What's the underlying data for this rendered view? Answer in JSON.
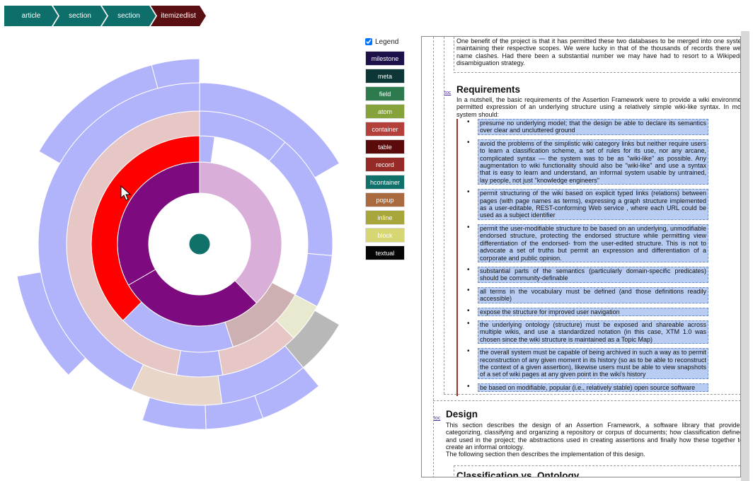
{
  "breadcrumb": [
    {
      "label": "article",
      "color": "#0e6e6a"
    },
    {
      "label": "section",
      "color": "#0e6e6a"
    },
    {
      "label": "section",
      "color": "#0e6e6a"
    },
    {
      "label": "itemizedlist",
      "color": "#5a0f12"
    }
  ],
  "legend": {
    "title": "Legend",
    "checked": true,
    "items": [
      {
        "label": "milestone",
        "color": "#1e1048"
      },
      {
        "label": "meta",
        "color": "#0d3636"
      },
      {
        "label": "field",
        "color": "#2c7a4e"
      },
      {
        "label": "atom",
        "color": "#86a23a"
      },
      {
        "label": "container",
        "color": "#b4403c"
      },
      {
        "label": "table",
        "color": "#5a0a0a"
      },
      {
        "label": "record",
        "color": "#962a26"
      },
      {
        "label": "hcontainer",
        "color": "#10706a"
      },
      {
        "label": "popup",
        "color": "#a86a3e"
      },
      {
        "label": "inline",
        "color": "#a6a63a"
      },
      {
        "label": "block",
        "color": "#d6d672"
      },
      {
        "label": "textual",
        "color": "#050505"
      }
    ]
  },
  "doc": {
    "intro_text": "One benefit of the project is that it has permitted these two databases to be merged into one system maintaining their respective scopes. We were lucky in that of the thousands of records there were name clashes. Had there been a substantial number we may have had to resort to a Wikipedia-disambiguation strategy.",
    "toc_label": "toc",
    "req_heading": "Requirements",
    "req_intro": "In a nutshell, the basic requirements of the Assertion Framework were to provide a wiki environment permitted expression of an underlying structure using a relatively simple wiki-like syntax. In more system should:",
    "req_items": [
      "presume no underlying model; that the design be able to declare its semantics over clear and uncluttered ground",
      "avoid the problems of the simplistic wiki category links but neither require users to learn a classification scheme, a set of rules for its use, nor any arcane, complicated syntax — the system was to be as \"wiki-like\" as possible. Any augmentation to wiki functionality should also be \"wiki-like\" and use a syntax that is easy to learn and understand, an informal system usable by untrained, lay people, not just \"knowledge engineers\"",
      "permit structuring of the wiki based on explicit typed links (relations) between pages (with page names as terms), expressing a graph structure implemented as a user-editable, REST-conforming Web service , where each URL could be used as a subject identifier",
      "permit the user-modifiable structure to be based on an underlying, unmodifiable endorsed structure, protecting the endorsed structure while permitting view differentiation of the endorsed- from the user-edited structure. This is not to advocate a set of truths but permit an expression and differentiation of a corporate and public opinion.",
      "substantial parts of the semantics (particularly domain-specific predicates) should be community-definable",
      "all terms in the vocabulary must be defined (and those definitions readily accessible)",
      "expose the structure for improved user navigation",
      "the underlying ontology (structure) must be exposed and shareable across multiple wikis, and use a standardized notation (in this case, XTM 1.0 was chosen since the wiki structure is maintained as a Topic Map)",
      "the overall system must be capable of being archived in such a way as to permit reconstruction of any given moment in its history (so as to be able to reconstruct the context of a given assertion), likewise users must be able to view snapshots of a set of wiki pages at any given point in the wiki's history",
      "be based on modifiable, popular (i.e., relatively stable) open source software"
    ],
    "design_heading": "Design",
    "design_text": "This section describes the design of an Assertion Framework, a software library that provides categorizing, classifying and organizing a repository or corpus of documents; how classification defined and used in the project; the abstractions used in creating assertions and finally how these together to create an informal ontology.",
    "design_text2": "The following section then describes the implementation of this design.",
    "next_heading": "Classification vs. Ontology"
  }
}
